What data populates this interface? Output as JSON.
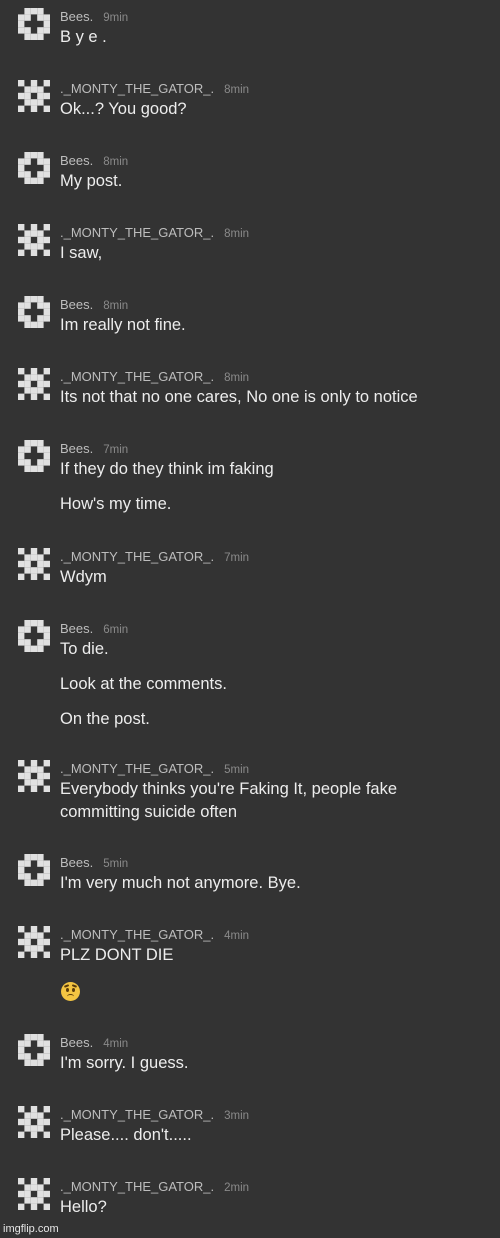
{
  "users": {
    "bees": "Bees.",
    "monty": "._MONTY_THE_GATOR_."
  },
  "messages": [
    {
      "author": "Bees.",
      "time": "9min",
      "lines": [
        "B y e ."
      ]
    },
    {
      "author": "._MONTY_THE_GATOR_.",
      "time": "8min",
      "lines": [
        "Ok...? You good?"
      ]
    },
    {
      "author": "Bees.",
      "time": "8min",
      "lines": [
        "My post."
      ]
    },
    {
      "author": "._MONTY_THE_GATOR_.",
      "time": "8min",
      "lines": [
        "I saw,"
      ]
    },
    {
      "author": "Bees.",
      "time": "8min",
      "lines": [
        "Im really not fine."
      ]
    },
    {
      "author": "._MONTY_THE_GATOR_.",
      "time": "8min",
      "lines": [
        "Its not that no one cares, No one is only to notice"
      ]
    },
    {
      "author": "Bees.",
      "time": "7min",
      "lines": [
        "If they do they think im faking",
        "How's my time."
      ]
    },
    {
      "author": "._MONTY_THE_GATOR_.",
      "time": "7min",
      "lines": [
        "Wdym"
      ]
    },
    {
      "author": "Bees.",
      "time": "6min",
      "lines": [
        "To die.",
        "Look at the comments.",
        "On the post."
      ]
    },
    {
      "author": "._MONTY_THE_GATOR_.",
      "time": "5min",
      "lines": [
        "Everybody thinks you're Faking It, people fake committing suicide often"
      ]
    },
    {
      "author": "Bees.",
      "time": "5min",
      "lines": [
        "I'm very much not anymore. Bye."
      ]
    },
    {
      "author": "._MONTY_THE_GATOR_.",
      "time": "4min",
      "lines": [
        "PLZ DONT DIE"
      ],
      "emoji": "worried-face-emoji"
    },
    {
      "author": "Bees.",
      "time": "4min",
      "lines": [
        "I'm sorry. I guess."
      ]
    },
    {
      "author": "._MONTY_THE_GATOR_.",
      "time": "3min",
      "lines": [
        "Please.... don't....."
      ]
    },
    {
      "author": "._MONTY_THE_GATOR_.",
      "time": "2min",
      "lines": [
        "Hello?"
      ]
    }
  ],
  "icons": {
    "bees_avatar": "pixel-avatar-icon",
    "monty_avatar": "pixel-avatar-icon"
  },
  "watermark": "imgflip.com",
  "colors": {
    "background": "#333333",
    "text": "#ededed",
    "author": "#bdbdbd",
    "time": "#8a8a8a",
    "avatar": "#e0e0e0"
  }
}
